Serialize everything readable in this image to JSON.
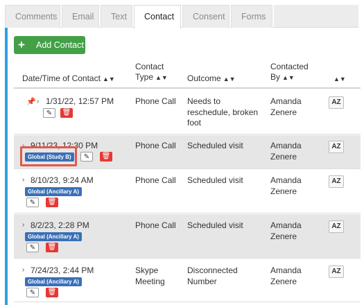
{
  "tabs": [
    {
      "label": "Comments"
    },
    {
      "label": "Email"
    },
    {
      "label": "Text"
    },
    {
      "label": "Contact",
      "active": true
    },
    {
      "label": "Consent"
    },
    {
      "label": "Forms"
    }
  ],
  "add_contact": {
    "label": "Add Contact",
    "icon": "plus-icon"
  },
  "columns": {
    "date": "Date/Time of Contact",
    "type": "Contact Type",
    "outcome": "Outcome",
    "by": "Contacted By"
  },
  "rows": [
    {
      "date": "1/31/22, 12:57 PM",
      "type": "Phone Call",
      "outcome": "Needs to reschedule, broken foot",
      "by": "Amanda Zenere",
      "badge": "",
      "pinned": true,
      "az": "AZ"
    },
    {
      "date": "9/11/23, 12:30 PM",
      "type": "Phone Call",
      "outcome": "Scheduled visit",
      "by": "Amanda Zenere",
      "badge": "Global (Study B)",
      "pinned": false,
      "az": "AZ"
    },
    {
      "date": "8/10/23, 9:24 AM",
      "type": "Phone Call",
      "outcome": "Scheduled visit",
      "by": "Amanda Zenere",
      "badge": "Global (Ancillary A)",
      "pinned": false,
      "az": "AZ"
    },
    {
      "date": "8/2/23, 2:28 PM",
      "type": "Phone Call",
      "outcome": "Scheduled visit",
      "by": "Amanda Zenere",
      "badge": "Global (Ancillary A)",
      "pinned": false,
      "az": "AZ"
    },
    {
      "date": "7/24/23, 2:44 PM",
      "type": "Skype Meeting",
      "outcome": "Disconnected Number",
      "by": "Amanda Zenere",
      "badge": "Global (Ancillary A)",
      "pinned": false,
      "az": "AZ"
    }
  ],
  "colors": {
    "accent": "#2f9fe6",
    "add_button": "#43a047",
    "badge": "#3a6fb7",
    "delete": "#e53935",
    "highlight": "#e2574c"
  }
}
